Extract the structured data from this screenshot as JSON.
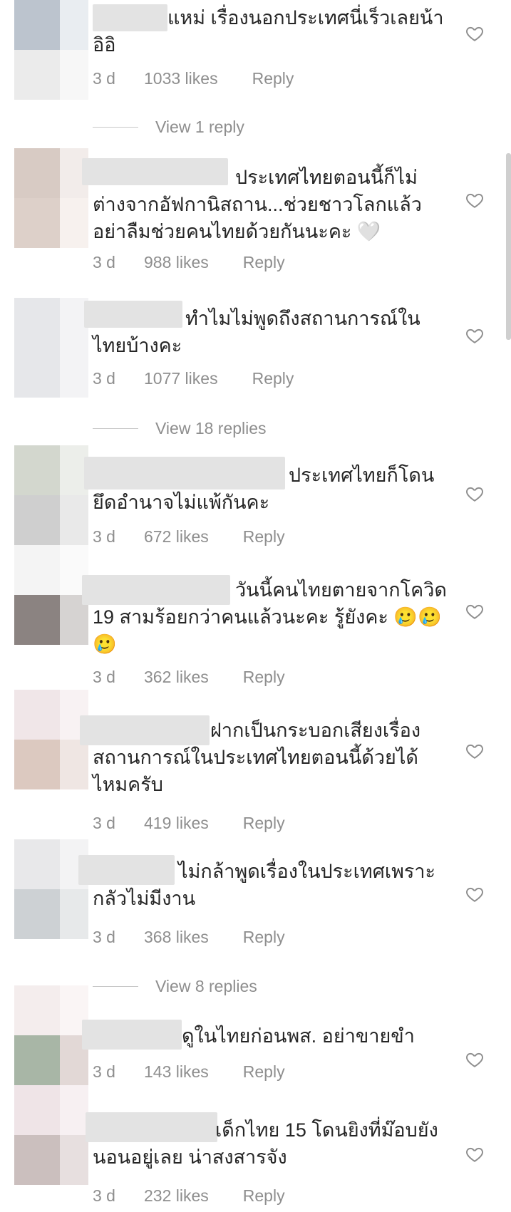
{
  "comments": [
    {
      "text": "แหม่ เรื่องนอกประเทศนี่เร็วเลยน้า\nอิอิ",
      "time": "3 d",
      "likes": "1033 likes",
      "reply": "Reply"
    },
    {
      "text": "ประเทศไทยตอนนี้ก็ไม่\nต่างจากอัฟกานิสถาน...ช่วยชาวโลกแล้ว\nอย่าลืมช่วยคนไทยด้วยกันนะคะ 🤍",
      "time": "3 d",
      "likes": "988 likes",
      "reply": "Reply"
    },
    {
      "text": "ทำไมไม่พูดถึงสถานการณ์ใน\nไทยบ้างคะ",
      "time": "3 d",
      "likes": "1077 likes",
      "reply": "Reply"
    },
    {
      "text": "ประเทศไทยก็โดน\nยึดอำนาจไม่แพ้กันคะ",
      "time": "3 d",
      "likes": "672 likes",
      "reply": "Reply"
    },
    {
      "text": "วันนี้คนไทยตายจากโควิด\n19 สามร้อยกว่าคนแล้วนะคะ รู้ยังคะ 🥲🥲\n🥲",
      "time": "3 d",
      "likes": "362 likes",
      "reply": "Reply"
    },
    {
      "text": "ฝากเป็นกระบอกเสียงเรื่อง\nสถานการณ์ในประเทศไทยตอนนี้ด้วยได้\nไหมครับ",
      "time": "3 d",
      "likes": "419 likes",
      "reply": "Reply"
    },
    {
      "text": "ไม่กล้าพูดเรื่องในประเทศเพราะ\nกลัวไม่มีงาน",
      "time": "3 d",
      "likes": "368 likes",
      "reply": "Reply"
    },
    {
      "text": "ดูในไทยก่อนพส. อย่าขายขำ",
      "time": "3 d",
      "likes": "143 likes",
      "reply": "Reply"
    },
    {
      "text": "เด็กไทย 15 โดนยิงที่ม๊อบยัง\nนอนอยู่เลย น่าสงสารจัง",
      "time": "3 d",
      "likes": "232 likes",
      "reply": "Reply"
    }
  ],
  "view_replies": [
    {
      "label": "View 1 reply"
    },
    {
      "label": "View 18 replies"
    },
    {
      "label": "View 8 replies"
    }
  ],
  "icons": {
    "like": "heart-outline-icon"
  },
  "colors": {
    "text": "#262626",
    "meta": "#8e8e8e",
    "heart": "#8e8e8e"
  }
}
